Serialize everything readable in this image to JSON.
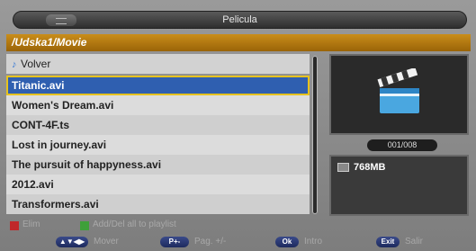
{
  "title": "Pelicula",
  "path": "/Udska1/Movie",
  "back_label": "Volver",
  "files": [
    {
      "name": "Titanic.avi",
      "selected": true
    },
    {
      "name": "Women's Dream.avi"
    },
    {
      "name": "CONT-4F.ts"
    },
    {
      "name": "Lost in journey.avi"
    },
    {
      "name": "The pursuit of happyness.avi"
    },
    {
      "name": "2012.avi"
    },
    {
      "name": "Transformers.avi"
    }
  ],
  "counter": "001/008",
  "file_size": "768MB",
  "legend": {
    "red_label": "Elim",
    "green_label": "Add/Del all to playlist"
  },
  "hints": {
    "move_key": "▲▼◀▶",
    "move_label": "Mover",
    "page_key": "P+-",
    "page_label": "Pag. +/-",
    "ok_key": "Ok",
    "ok_label": "Intro",
    "exit_key": "Exit",
    "exit_label": "Salir"
  },
  "colors": {
    "path_bar": "#b57a12",
    "selected_row": "#2f5fb0",
    "selected_border": "#e6c21e"
  },
  "icons": {
    "preview": "clapperboard-icon",
    "size": "file-icon",
    "back": "music-note-icon"
  }
}
